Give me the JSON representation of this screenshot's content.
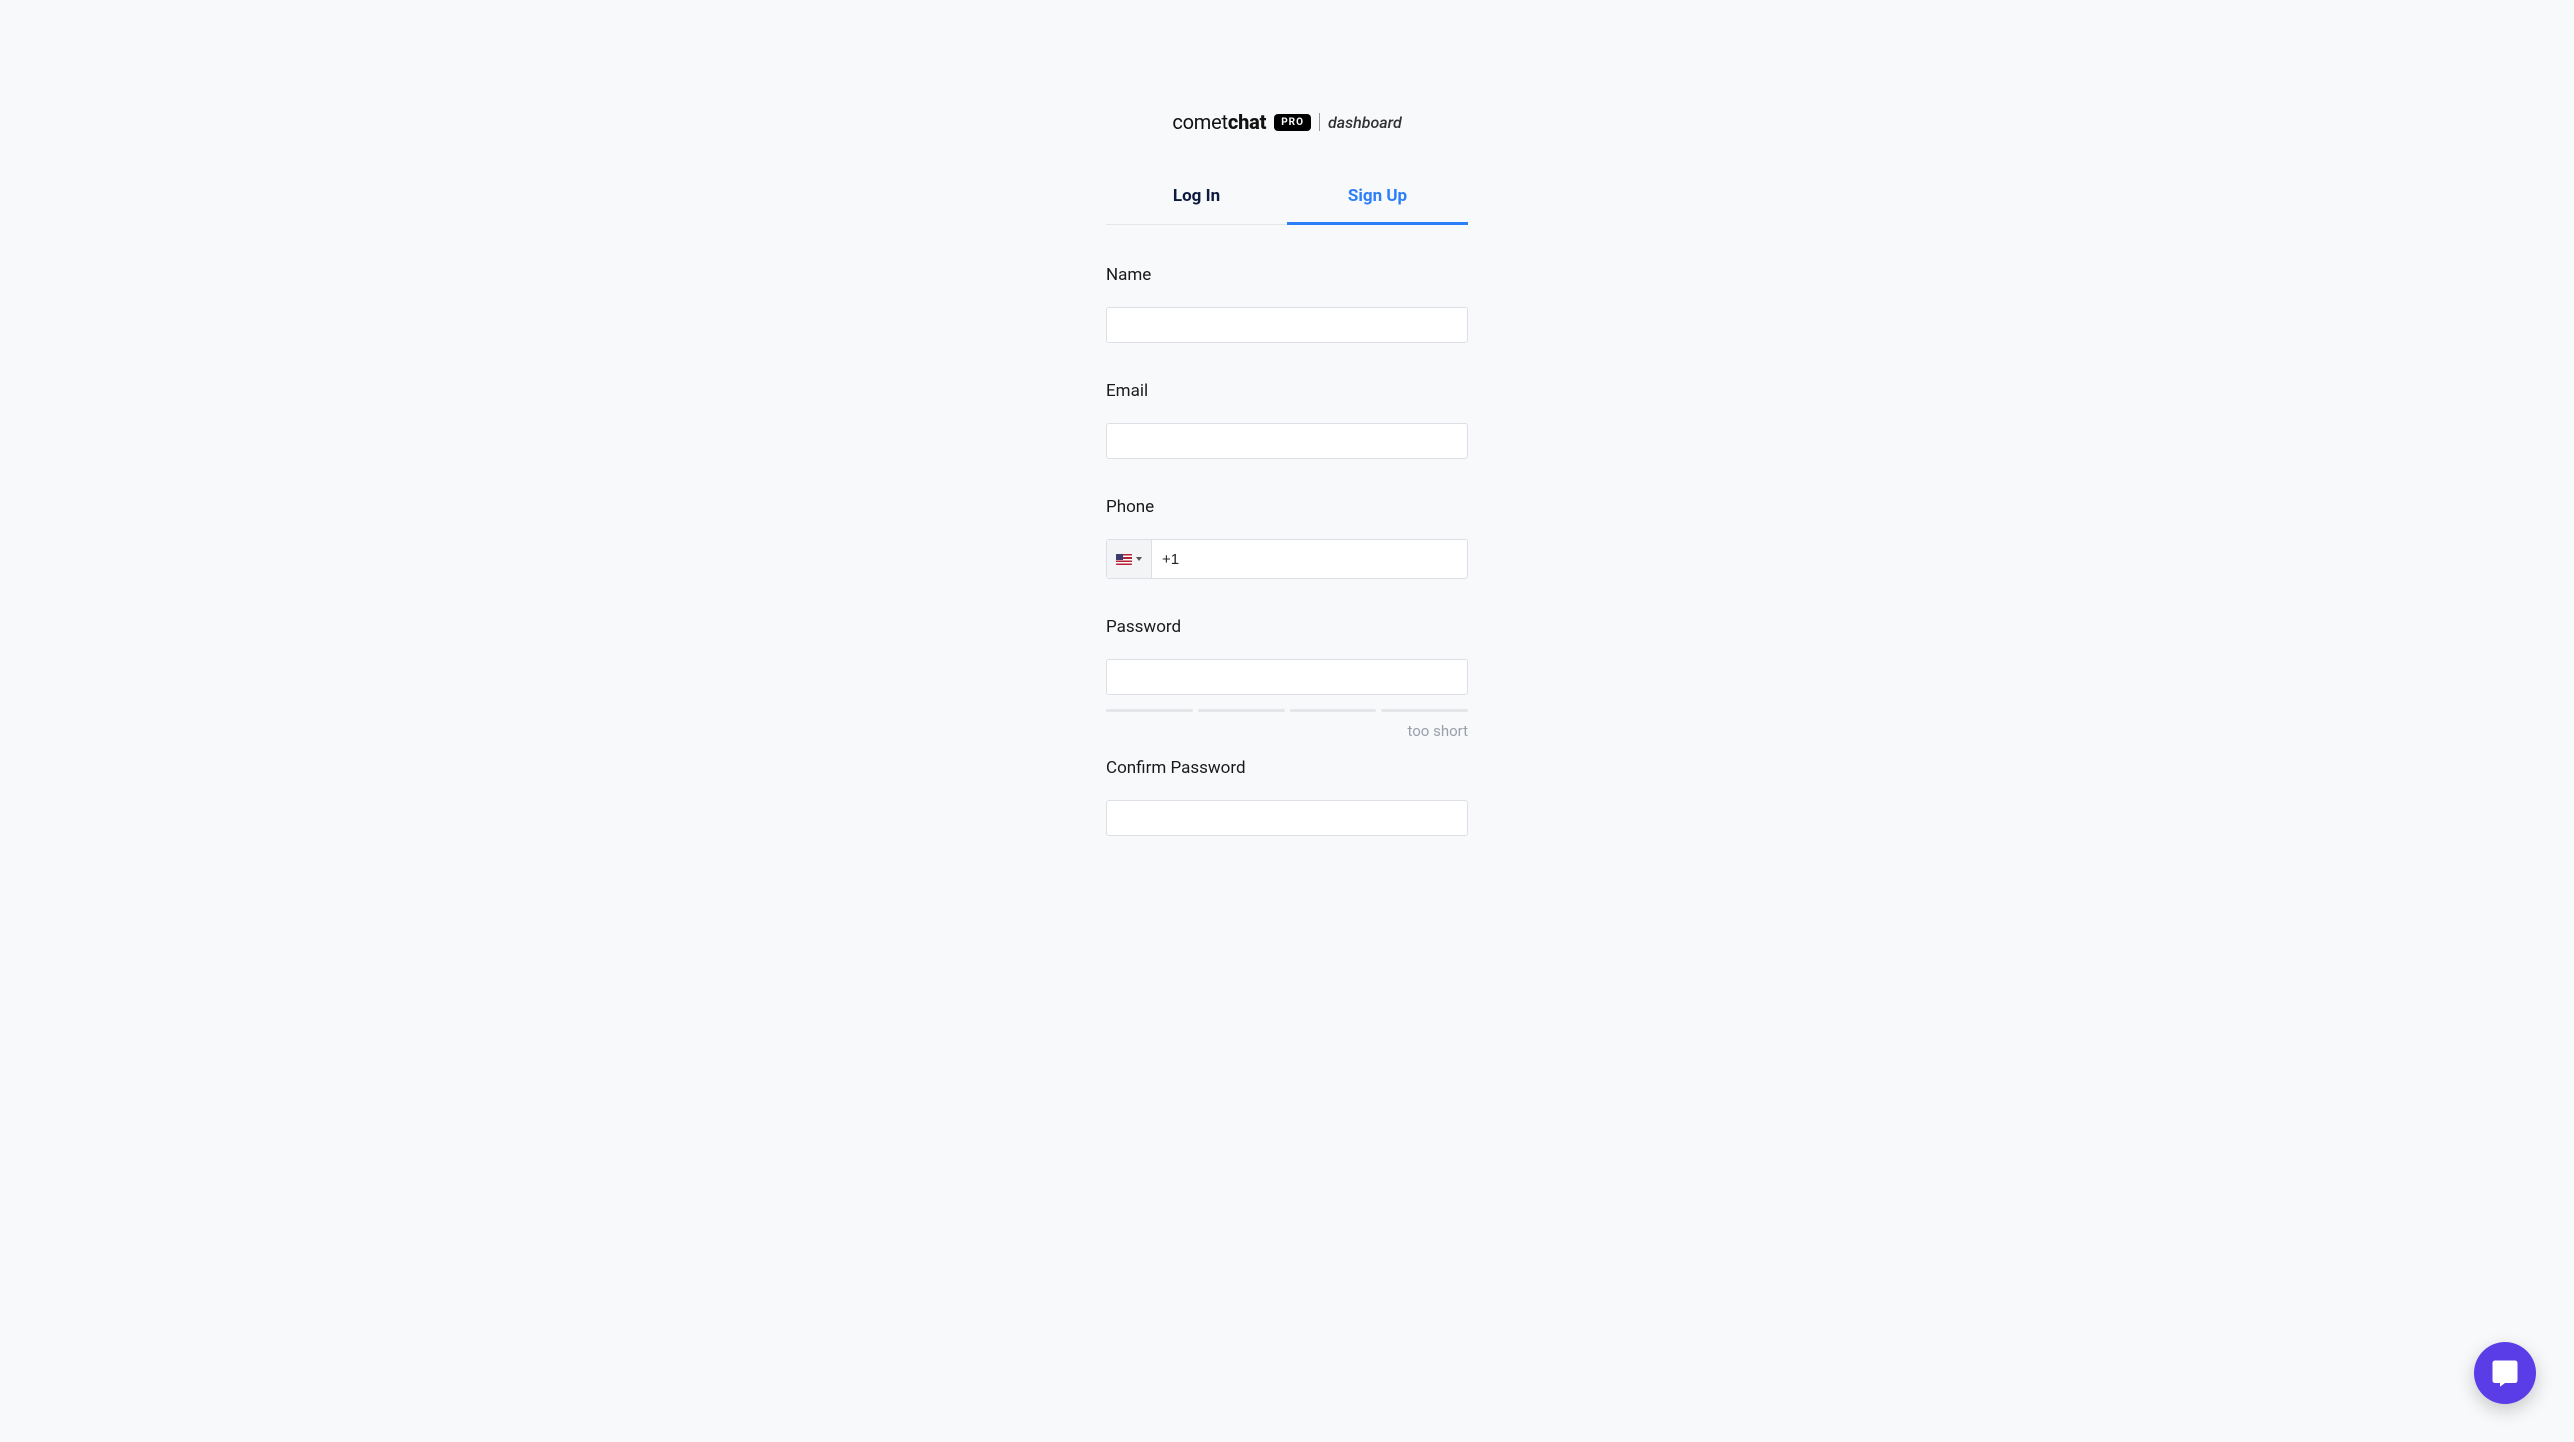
{
  "brand": {
    "name_light": "comet",
    "name_bold": "chat",
    "badge": "PRO",
    "sub": "dashboard"
  },
  "tabs": {
    "login": "Log In",
    "signup": "Sign Up"
  },
  "labels": {
    "name": "Name",
    "email": "Email",
    "phone": "Phone",
    "password": "Password",
    "confirm_password": "Confirm Password"
  },
  "phone": {
    "country_flag": "us",
    "value": "+1"
  },
  "password_strength": "too short",
  "values": {
    "name": "",
    "email": "",
    "password": "",
    "confirm_password": ""
  }
}
